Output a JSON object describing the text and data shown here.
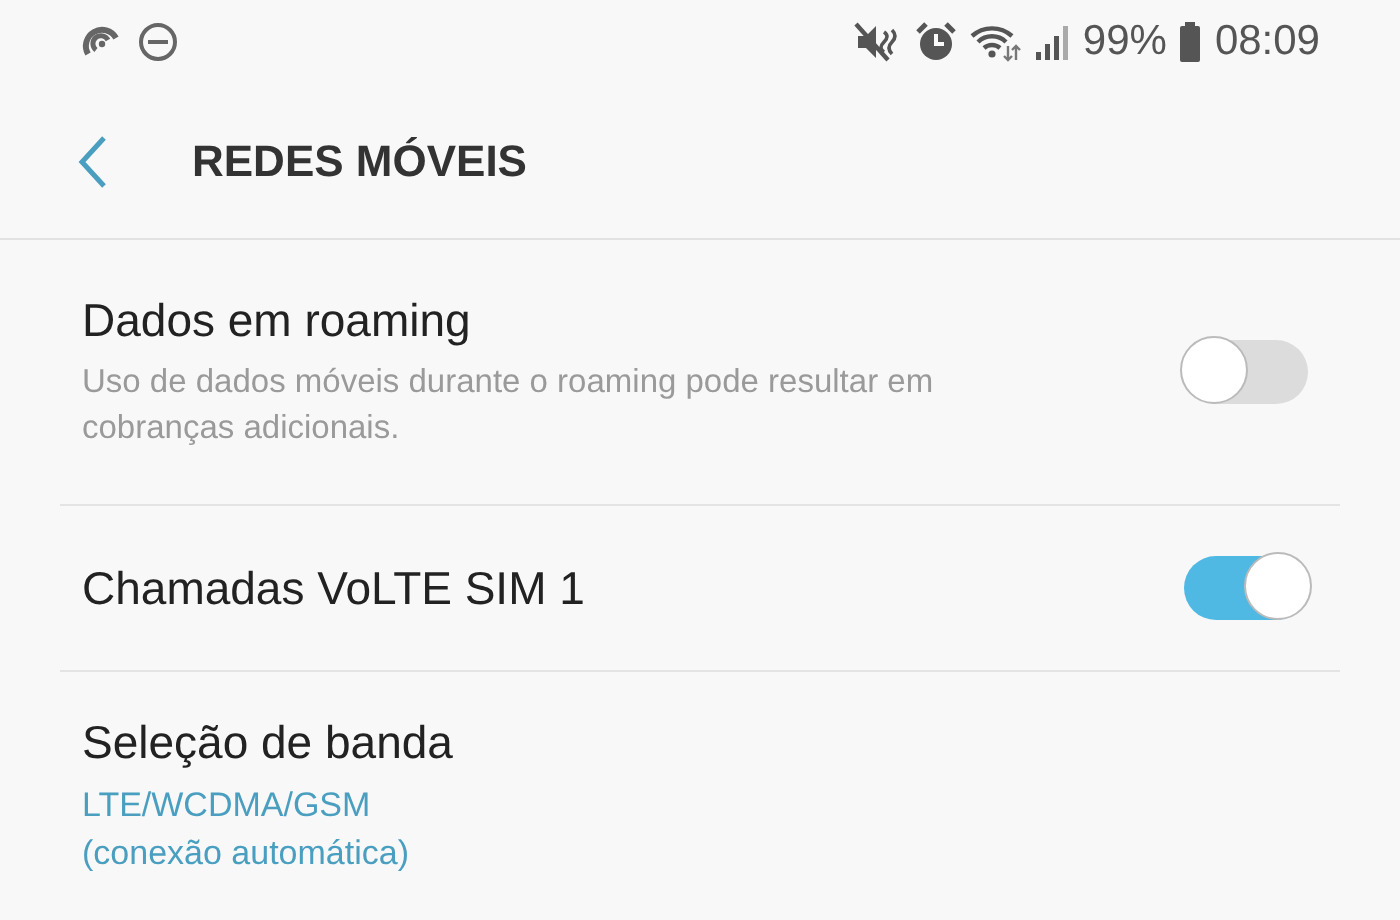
{
  "status_bar": {
    "battery_text": "99%",
    "time": "08:09"
  },
  "header": {
    "title": "REDES MÓVEIS"
  },
  "settings": [
    {
      "kind": "toggle",
      "title": "Dados em roaming",
      "description": "Uso de dados móveis durante o roaming pode resultar em cobranças adicionais.",
      "on": false
    },
    {
      "kind": "toggle",
      "title": "Chamadas VoLTE SIM 1",
      "on": true
    },
    {
      "kind": "value",
      "title": "Seleção de banda",
      "value_lines": [
        "LTE/WCDMA/GSM",
        "(conexão automática)"
      ]
    }
  ]
}
